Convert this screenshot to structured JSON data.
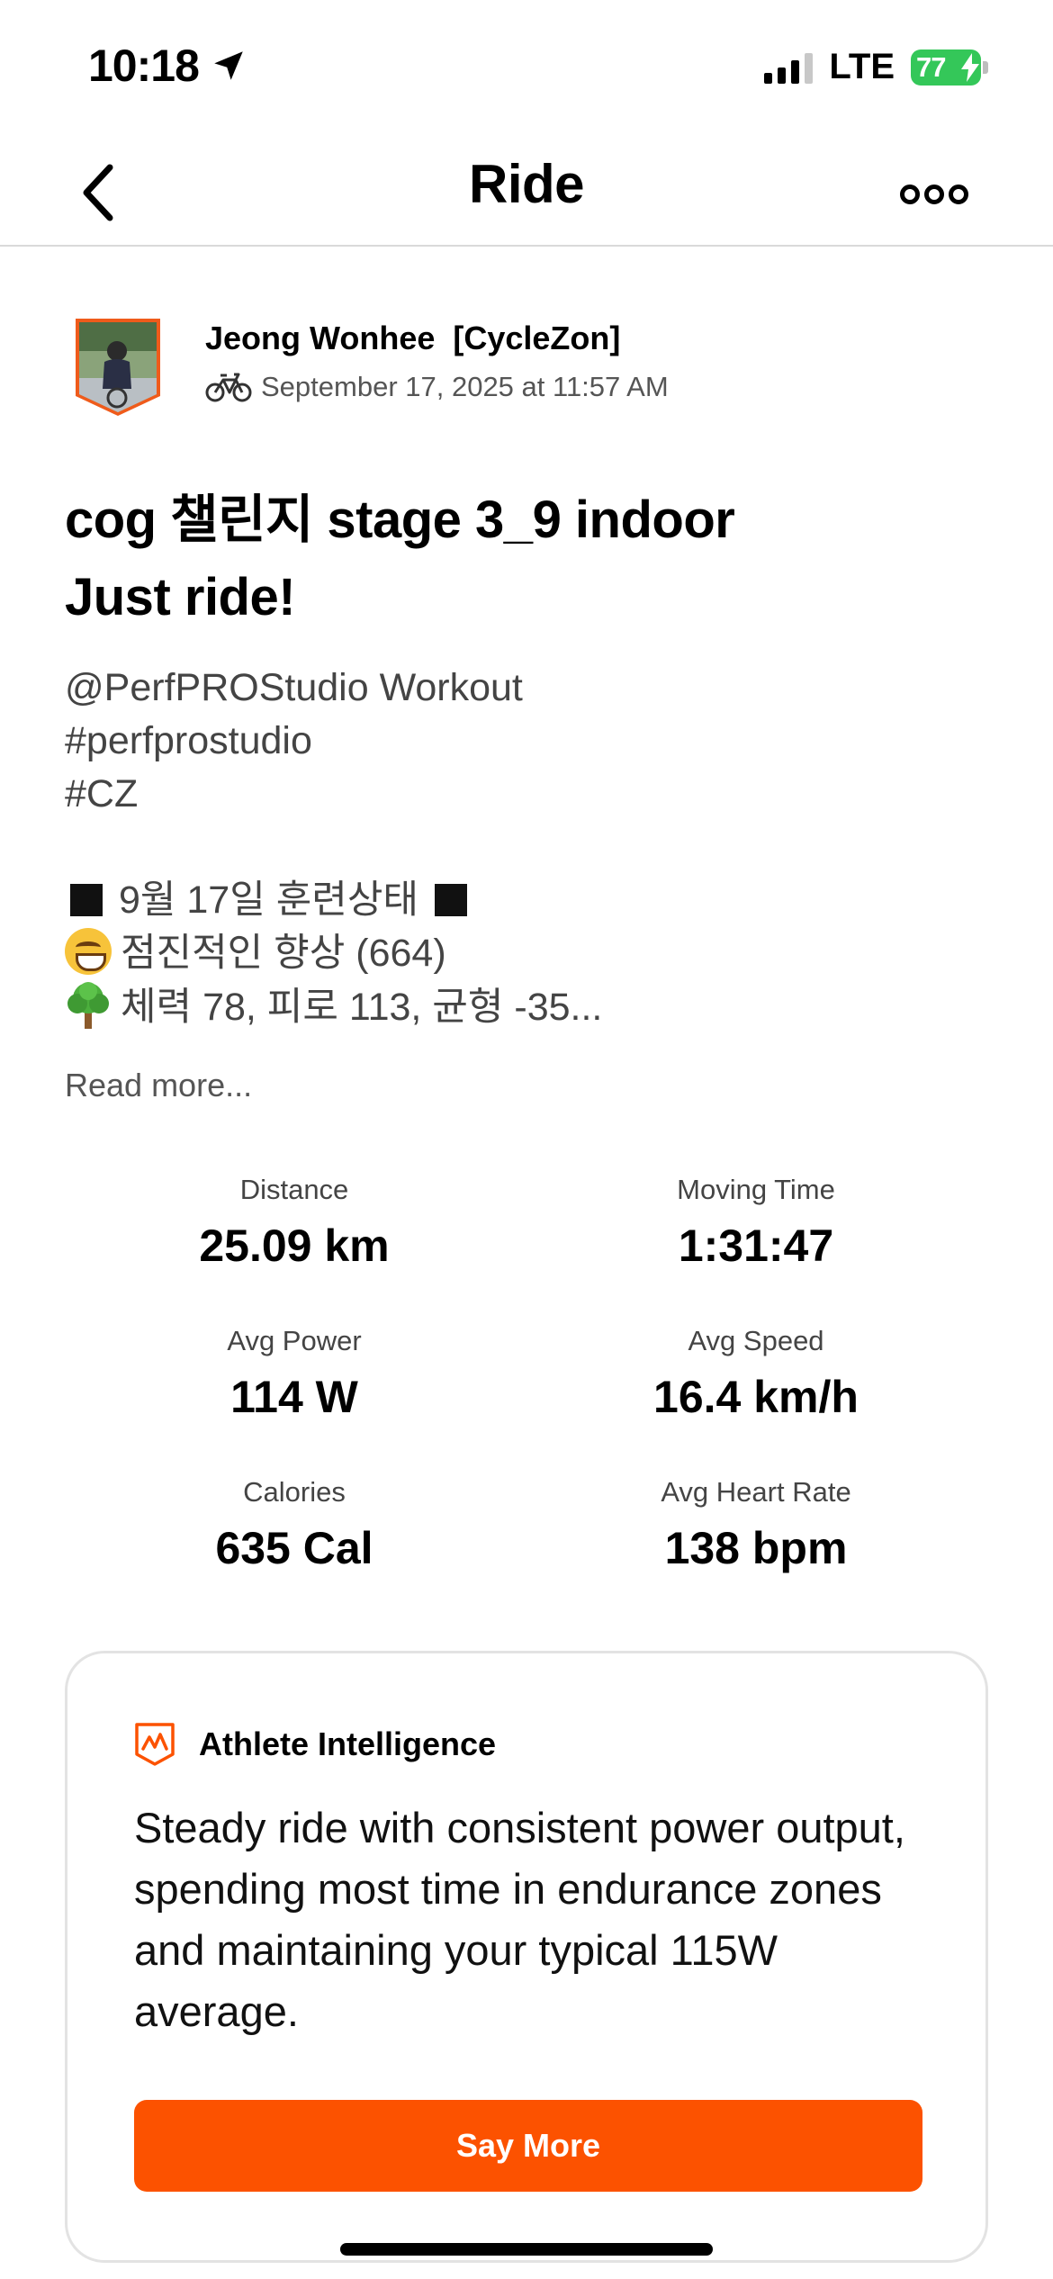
{
  "status_bar": {
    "time": "10:18",
    "network": "LTE",
    "battery": "77",
    "battery_color": "#34c759"
  },
  "nav": {
    "title": "Ride",
    "back_icon": "chevron-left-icon",
    "more_icon": "more-options-icon"
  },
  "athlete": {
    "name": "Jeong Wonhee  [CycleZon]",
    "activity_icon": "bike-icon",
    "date": "September 17, 2025 at 11:57 AM"
  },
  "activity": {
    "title_lines": [
      "cog 챌린지 stage 3_9 indoor",
      "Just ride!"
    ],
    "description": {
      "line1": "@PerfPROStudio Workout",
      "line2": "#perfprostudio",
      "line3": "#CZ",
      "line4_text": "9월 17일 훈련상태",
      "line5_text": "점진적인 향상 (664)",
      "line6_text": "체력 78, 피로 113, 균형 -35..."
    },
    "read_more": "Read more..."
  },
  "stats": [
    {
      "label": "Distance",
      "value": "25.09 km"
    },
    {
      "label": "Moving Time",
      "value": "1:31:47"
    },
    {
      "label": "Avg Power",
      "value": "114 W"
    },
    {
      "label": "Avg Speed",
      "value": "16.4 km/h"
    },
    {
      "label": "Calories",
      "value": "635 Cal"
    },
    {
      "label": "Avg Heart Rate",
      "value": "138 bpm"
    }
  ],
  "athlete_intelligence": {
    "icon": "athlete-intelligence-icon",
    "title": "Athlete Intelligence",
    "summary": "Steady ride with consistent power output, spending most time in endurance zones and maintaining your typical 115W average.",
    "button_label": "Say More",
    "accent_color": "#fc5200"
  }
}
